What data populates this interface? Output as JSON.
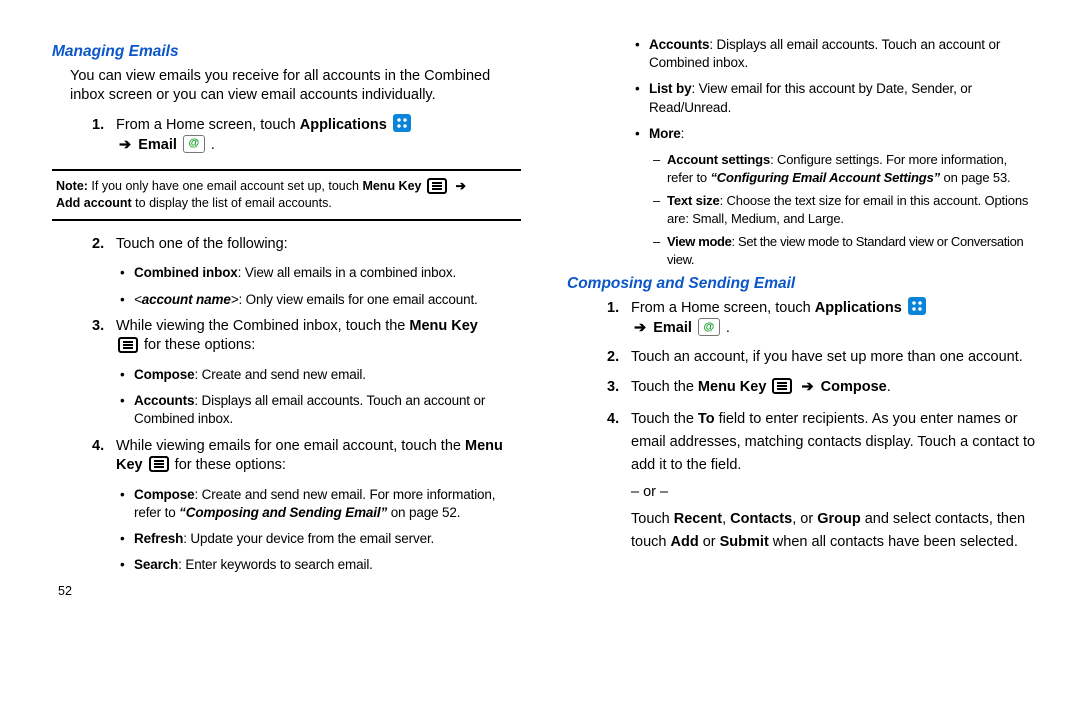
{
  "left": {
    "h1": "Managing Emails",
    "intro": "You can view emails you receive for all accounts in the Combined inbox screen or you can view email accounts individually.",
    "step1_num": "1.",
    "step1_a": "From a Home screen, touch ",
    "step1_apps": "Applications",
    "step1_arrow": "➔",
    "step1_email": "Email",
    "note_label": "Note:",
    "note1": " If you only have one email account set up, touch ",
    "note_menu": "Menu Key",
    "note_arrow": "➔",
    "note2": "Add account",
    "note3": " to display the list of email accounts.",
    "step2_num": "2.",
    "step2": "Touch one of the following:",
    "b2a_bold": "Combined inbox",
    "b2a_rest": ": View all emails in a combined inbox.",
    "b2b_lead": "<",
    "b2b_bold": "account name",
    "b2b_mid": ">",
    "b2b_rest": ": Only view emails for one email account.",
    "step3_num": "3.",
    "step3_a": "While viewing the Combined inbox, touch the ",
    "step3_menu": "Menu Key",
    "step3_b": " for these options:",
    "b3a_bold": "Compose",
    "b3a_rest": ": Create and send new email.",
    "b3b_bold": "Accounts",
    "b3b_rest": ": Displays all email accounts. Touch an account or Combined inbox.",
    "step4_num": "4.",
    "step4_a": "While viewing emails for one email account, touch the ",
    "step4_menu": "Menu Key",
    "step4_b": " for these options:",
    "b4a_bold": "Compose",
    "b4a_rest": ": Create and send new email. For more information, refer to ",
    "b4a_italic": "“Composing and Sending Email”",
    "b4a_tail": "  on page 52.",
    "b4b_bold": "Refresh",
    "b4b_rest": ": Update your device from the email server.",
    "b4c_bold": "Search",
    "b4c_rest": ": Enter keywords to search email."
  },
  "right": {
    "bAcc_bold": "Accounts",
    "bAcc_rest": ": Displays all email accounts. Touch an account or Combined inbox.",
    "bList_bold": "List by",
    "bList_rest": ": View email for this account by Date, Sender, or Read/Unread.",
    "bMore_bold": "More",
    "bMore_rest": ":",
    "d1_bold": "Account settings",
    "d1_rest": ": Configure settings. For more information, refer to ",
    "d1_italic": "“Configuring Email Account Settings”",
    "d1_tail": "  on page 53.",
    "d2_bold": "Text size",
    "d2_rest": ": Choose the text size for email in this account. Options are: Small, Medium, and Large.",
    "d3_bold": "View mode",
    "d3_rest": ": Set the view mode to Standard view or Conversation view.",
    "h2": "Composing and Sending Email",
    "c1_num": "1.",
    "c1_a": "From a Home screen, touch ",
    "c1_apps": "Applications",
    "c1_arrow": "➔",
    "c1_email": "Email",
    "c2_num": "2.",
    "c2": "Touch an account, if you have set up more than one account.",
    "c3_num": "3.",
    "c3_a": "Touch the ",
    "c3_menu": "Menu Key",
    "c3_arrow": "➔",
    "c3_compose": "Compose",
    "c4_num": "4.",
    "c4_a": "Touch the ",
    "c4_to": "To",
    "c4_b": " field to enter recipients. As you enter names or email addresses, matching contacts display. Touch a contact to add it to the field.",
    "c4_or": "– or –",
    "c4_c": "Touch ",
    "c4_recent": "Recent",
    "c4_d": ", ",
    "c4_contacts": "Contacts",
    "c4_e": ", or ",
    "c4_group": "Group",
    "c4_f": " and select contacts, then touch ",
    "c4_add": "Add",
    "c4_g": " or ",
    "c4_submit": "Submit",
    "c4_h": " when all contacts have been selected."
  },
  "page_number": "52"
}
